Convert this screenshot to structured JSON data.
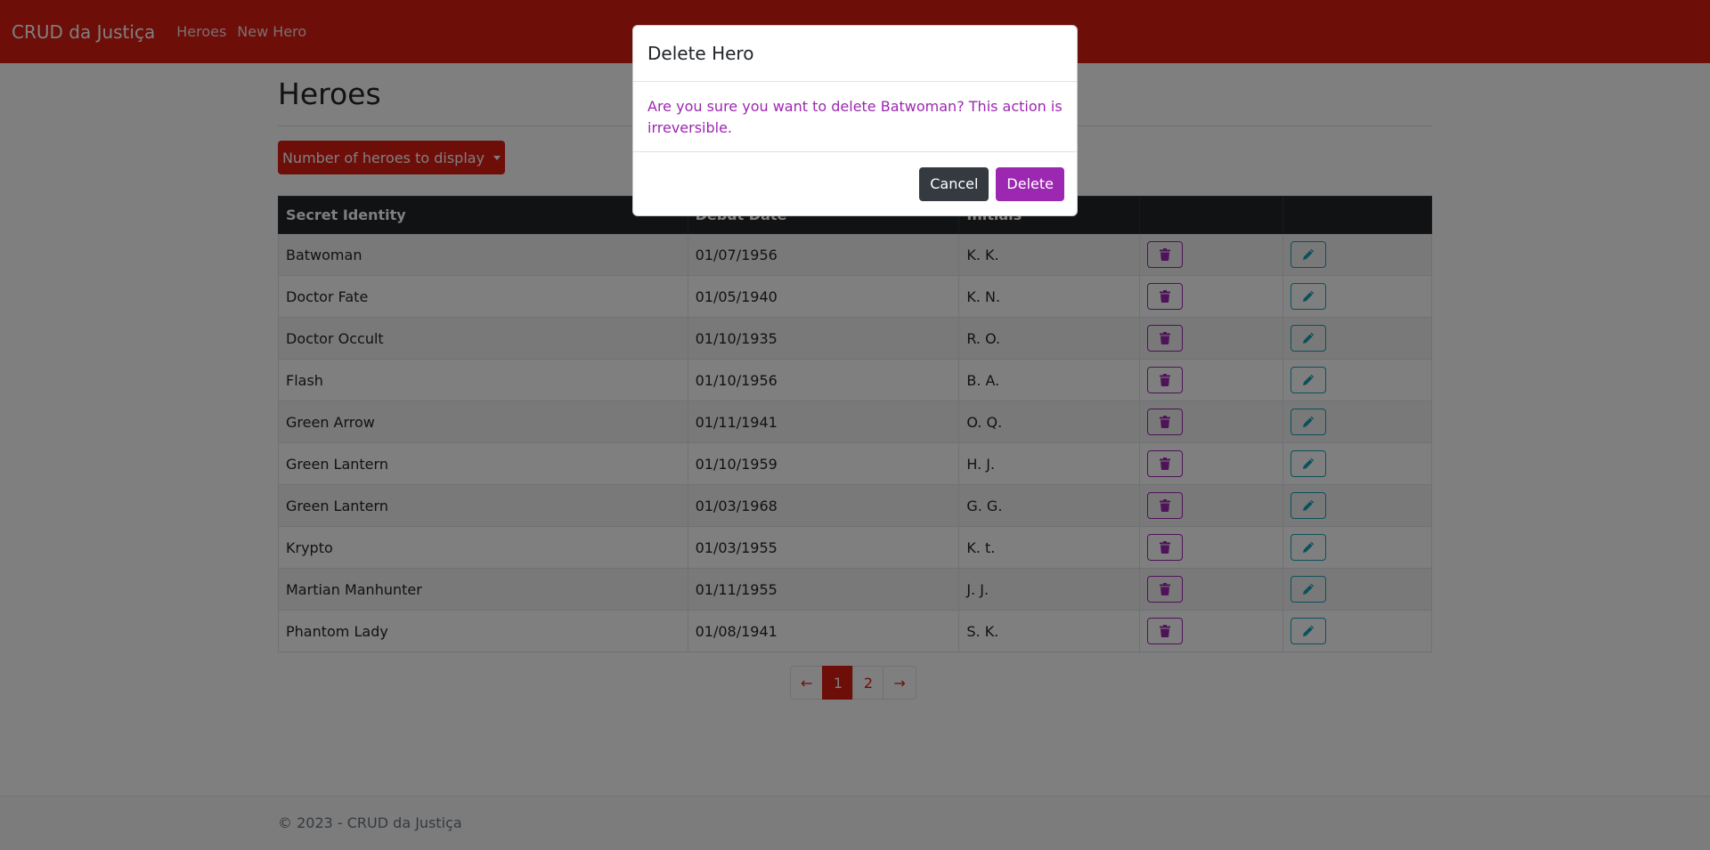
{
  "navbar": {
    "brand": "CRUD da Justiça",
    "links": [
      "Heroes",
      "New Hero"
    ],
    "color": "#dc1c13"
  },
  "page": {
    "title": "Heroes",
    "dropdown_label": "Number of heroes to display"
  },
  "table": {
    "headers": [
      "Secret Identity",
      "Debut Date",
      "Initials",
      "",
      ""
    ],
    "rows": [
      {
        "identity": "Batwoman",
        "debut": "01/07/1956",
        "initials": "K. K."
      },
      {
        "identity": "Doctor Fate",
        "debut": "01/05/1940",
        "initials": "K. N."
      },
      {
        "identity": "Doctor Occult",
        "debut": "01/10/1935",
        "initials": "R. O."
      },
      {
        "identity": "Flash",
        "debut": "01/10/1956",
        "initials": "B. A."
      },
      {
        "identity": "Green Arrow",
        "debut": "01/11/1941",
        "initials": "O. Q."
      },
      {
        "identity": "Green Lantern",
        "debut": "01/10/1959",
        "initials": "H. J."
      },
      {
        "identity": "Green Lantern",
        "debut": "01/03/1968",
        "initials": "G. G."
      },
      {
        "identity": "Krypto",
        "debut": "01/03/1955",
        "initials": "K. t."
      },
      {
        "identity": "Martian Manhunter",
        "debut": "01/11/1955",
        "initials": "J. J."
      },
      {
        "identity": "Phantom Lady",
        "debut": "01/08/1941",
        "initials": "S. K."
      }
    ],
    "delete_icon": "trash-icon",
    "edit_icon": "pencil-icon"
  },
  "pagination": {
    "prev": "←",
    "pages": [
      "1",
      "2"
    ],
    "active_page": "1",
    "next": "→"
  },
  "footer": {
    "text": "© 2023 - CRUD da Justiça"
  },
  "modal": {
    "title": "Delete Hero",
    "message": "Are you sure you want to delete Batwoman? This action is irreversible.",
    "cancel_label": "Cancel",
    "confirm_label": "Delete",
    "accent": "#9c27b0"
  }
}
